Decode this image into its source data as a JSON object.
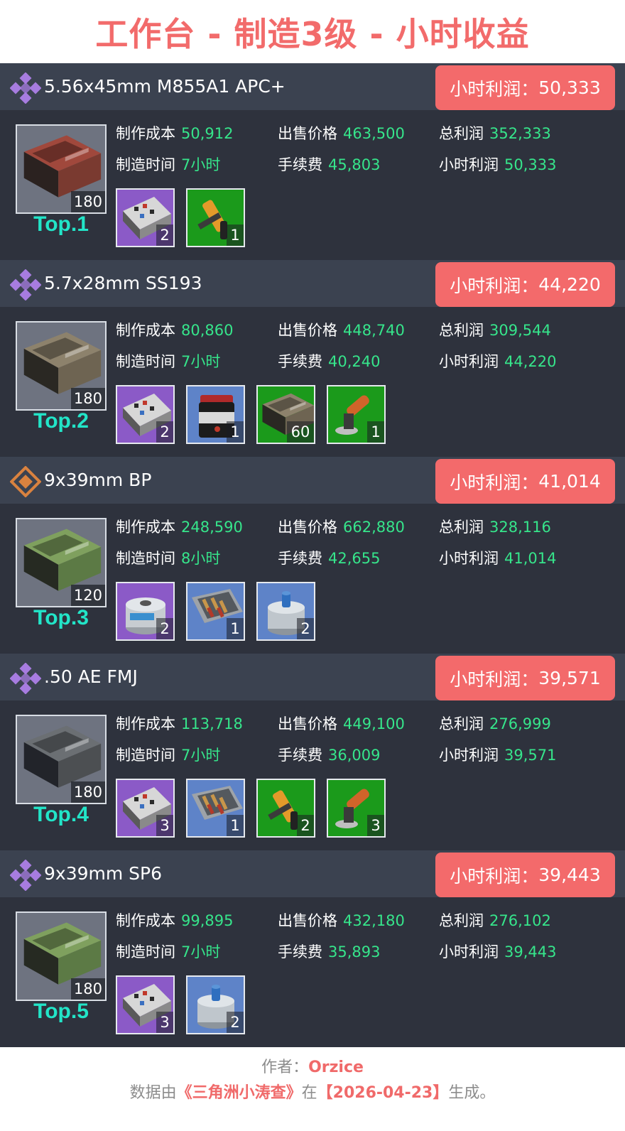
{
  "page_title": "工作台 - 制造3级 - 小时收益",
  "labels": {
    "cost": "制作成本",
    "sell": "出售价格",
    "total": "总利润",
    "time": "制造时间",
    "fee": "手续费",
    "hourly": "小时利润",
    "badge_prefix": "小时利润："
  },
  "colors": {
    "title": "#f26b6b",
    "badge": "#f36a6b",
    "value_green": "#36e58b",
    "rank_cyan": "#22e5c8",
    "card_bg": "#2e323d",
    "header_bg": "#3b4250"
  },
  "items": [
    {
      "name": "5.56x45mm M855A1 APC+",
      "rarity_icon": "purple-diamond-icon",
      "rarity_color": "#a77ce0",
      "hourly_badge": "50,333",
      "cost": "50,912",
      "sell": "463,500",
      "total": "352,333",
      "time": "7小时",
      "fee": "45,803",
      "hourly": "50,333",
      "output_count": "180",
      "thumb_icon": "ammo-box-red-icon",
      "rank": "Top.1",
      "materials": [
        {
          "icon": "circuit-board-icon",
          "bg": "purple",
          "count": "2"
        },
        {
          "icon": "drill-tool-icon",
          "bg": "green",
          "count": "1"
        }
      ]
    },
    {
      "name": "5.7x28mm SS193",
      "rarity_icon": "purple-diamond-icon",
      "rarity_color": "#a77ce0",
      "hourly_badge": "44,220",
      "cost": "80,860",
      "sell": "448,740",
      "total": "309,544",
      "time": "7小时",
      "fee": "40,240",
      "hourly": "44,220",
      "output_count": "180",
      "thumb_icon": "ammo-box-tan-icon",
      "rank": "Top.2",
      "materials": [
        {
          "icon": "circuit-board-icon",
          "bg": "purple",
          "count": "2"
        },
        {
          "icon": "powder-jar-icon",
          "bg": "blue",
          "count": "1"
        },
        {
          "icon": "ammo-box-tan-icon",
          "bg": "green",
          "count": "60"
        },
        {
          "icon": "angle-grinder-icon",
          "bg": "green",
          "count": "1"
        }
      ]
    },
    {
      "name": "9x39mm BP",
      "rarity_icon": "orange-diamond-icon",
      "rarity_color": "#d9823f",
      "hourly_badge": "41,014",
      "cost": "248,590",
      "sell": "662,880",
      "total": "328,116",
      "time": "8小时",
      "fee": "42,655",
      "hourly": "41,014",
      "output_count": "120",
      "thumb_icon": "ammo-box-green-icon",
      "rank": "Top.3",
      "materials": [
        {
          "icon": "fuel-canister-icon",
          "bg": "purple",
          "count": "2"
        },
        {
          "icon": "cartridge-tray-icon",
          "bg": "blue",
          "count": "1"
        },
        {
          "icon": "fuel-canister-blue-icon",
          "bg": "blue",
          "count": "2"
        }
      ]
    },
    {
      "name": ".50 AE FMJ",
      "rarity_icon": "purple-diamond-icon",
      "rarity_color": "#a77ce0",
      "hourly_badge": "39,571",
      "cost": "113,718",
      "sell": "449,100",
      "total": "276,999",
      "time": "7小时",
      "fee": "36,009",
      "hourly": "39,571",
      "output_count": "180",
      "thumb_icon": "ammo-box-grey-icon",
      "rank": "Top.4",
      "materials": [
        {
          "icon": "circuit-board-icon",
          "bg": "purple",
          "count": "3"
        },
        {
          "icon": "cartridge-tray-icon",
          "bg": "blue",
          "count": "1"
        },
        {
          "icon": "drill-tool-icon",
          "bg": "green",
          "count": "2"
        },
        {
          "icon": "angle-grinder-icon",
          "bg": "green",
          "count": "3"
        }
      ]
    },
    {
      "name": "9x39mm SP6",
      "rarity_icon": "purple-diamond-icon",
      "rarity_color": "#a77ce0",
      "hourly_badge": "39,443",
      "cost": "99,895",
      "sell": "432,180",
      "total": "276,102",
      "time": "7小时",
      "fee": "35,893",
      "hourly": "39,443",
      "output_count": "180",
      "thumb_icon": "ammo-box-green-icon",
      "rank": "Top.5",
      "materials": [
        {
          "icon": "circuit-board-icon",
          "bg": "purple",
          "count": "3"
        },
        {
          "icon": "fuel-canister-blue-icon",
          "bg": "blue",
          "count": "2"
        }
      ]
    }
  ],
  "footer": {
    "author_label": "作者：",
    "author_name": "Orzice",
    "data_prefix": "数据由",
    "data_source": "《三角洲小涛查》",
    "data_mid": "在",
    "data_date": "【2026-04-23】",
    "data_suffix": "生成。"
  }
}
